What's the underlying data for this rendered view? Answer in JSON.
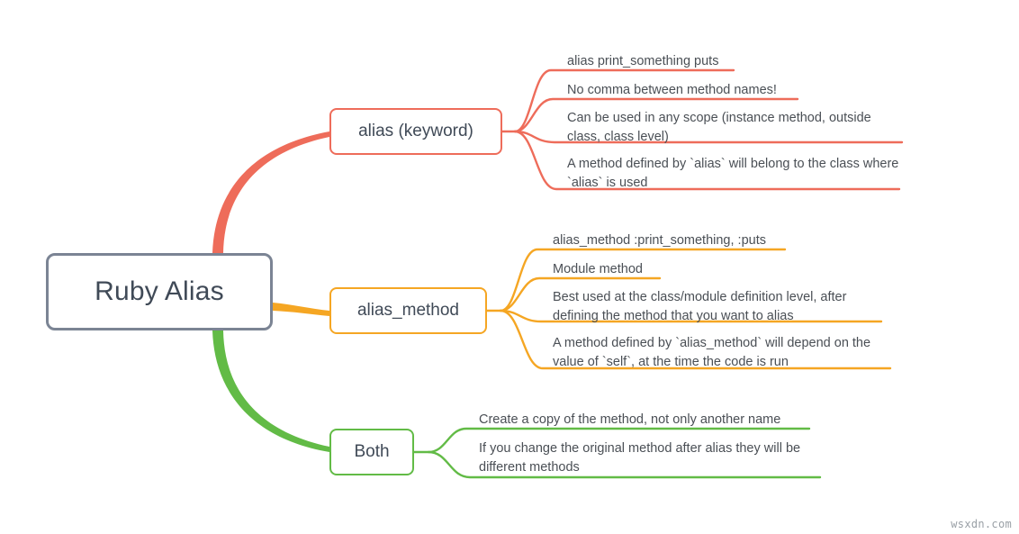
{
  "diagram": {
    "type": "mindmap",
    "title": "Ruby Alias",
    "watermark": "wsxdn.com",
    "colors": {
      "root_border": "#7b8494",
      "branch_red": "#ee6c5a",
      "branch_yellow": "#f5a623",
      "branch_green": "#62bb46",
      "text": "#4a4f55",
      "background": "#ffffff"
    },
    "root": {
      "label": "Ruby Alias"
    },
    "branches": [
      {
        "id": "alias-keyword",
        "label": "alias (keyword)",
        "color": "#ee6c5a",
        "leaves": [
          {
            "text": "alias print_something puts"
          },
          {
            "text": "No comma between method names!"
          },
          {
            "text": "Can be used in any scope (instance method, outside class, class level)"
          },
          {
            "text": "A method defined by `alias` will belong to the class where `alias` is used"
          }
        ]
      },
      {
        "id": "alias-method",
        "label": "alias_method",
        "color": "#f5a623",
        "leaves": [
          {
            "text": "alias_method :print_something, :puts"
          },
          {
            "text": "Module method"
          },
          {
            "text": "Best used at the class/module definition level, after defining the method that you want to alias"
          },
          {
            "text": "A method defined by `alias_method` will depend on the value of `self`, at the time the code is run"
          }
        ]
      },
      {
        "id": "both",
        "label": "Both",
        "color": "#62bb46",
        "leaves": [
          {
            "text": "Create a copy of the method, not only another name"
          },
          {
            "text": "If you change the original method after alias they will be different methods"
          }
        ]
      }
    ]
  }
}
